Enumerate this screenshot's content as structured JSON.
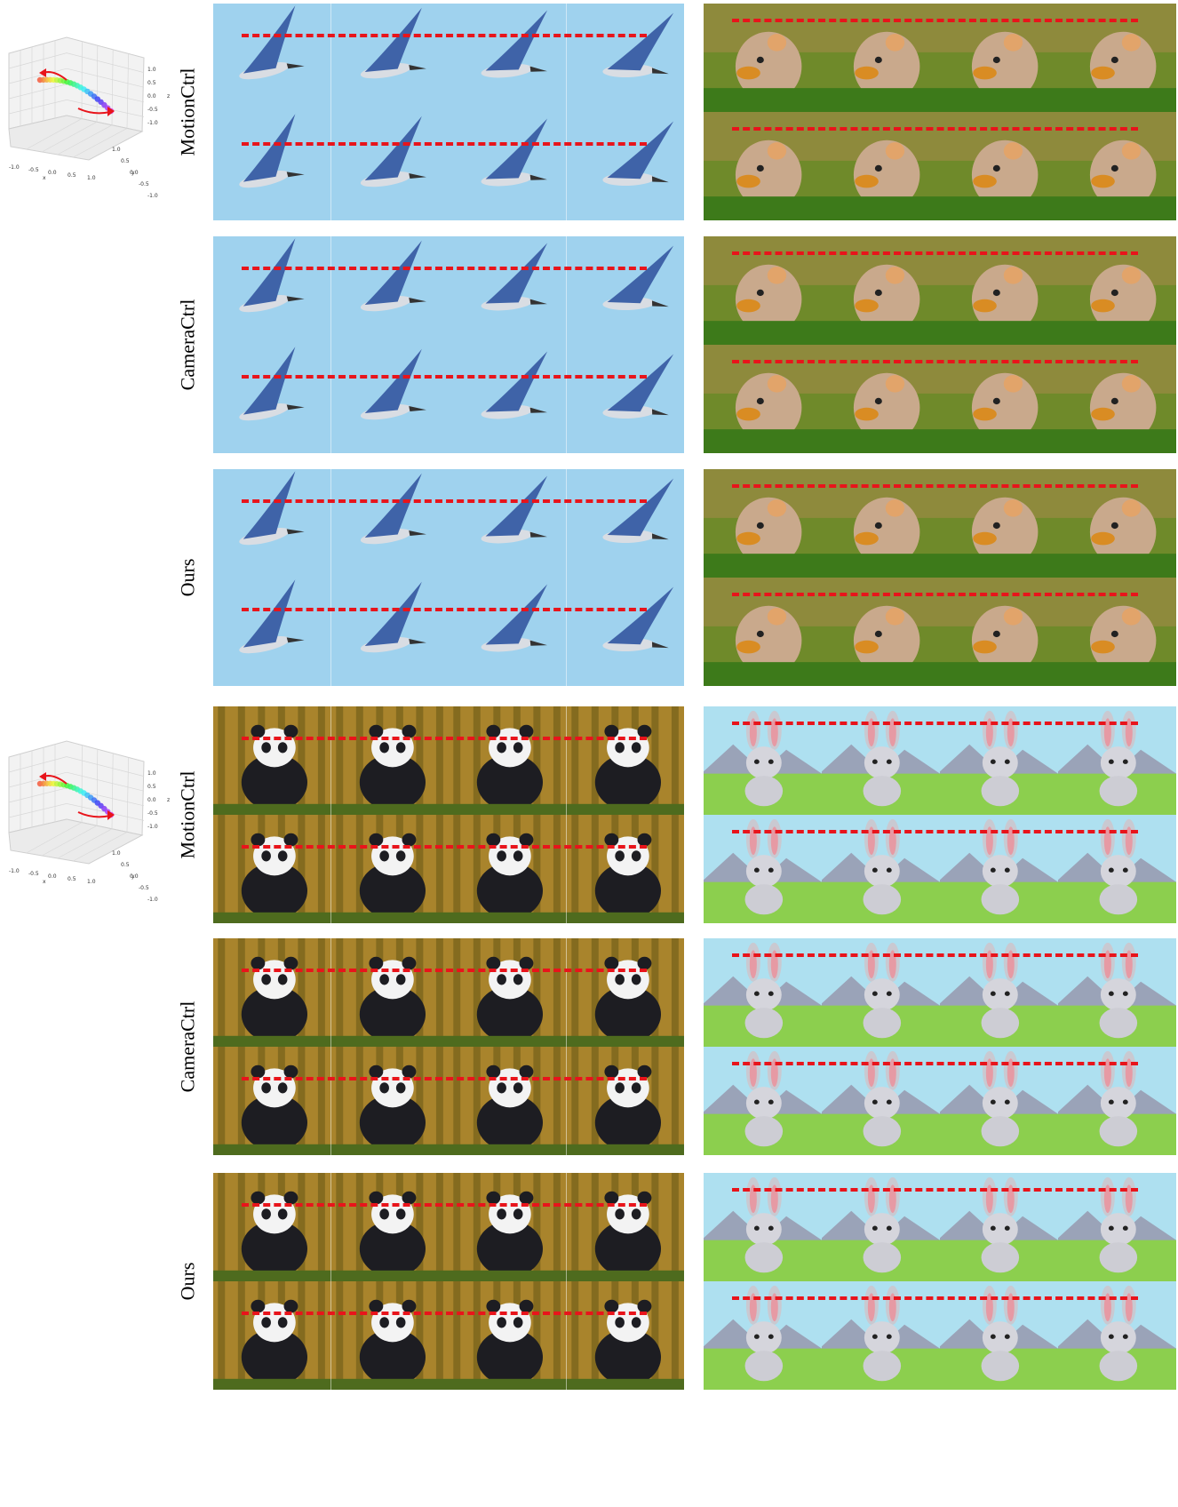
{
  "figure": {
    "row_labels": [
      "MotionCtrl",
      "CameraCtrl",
      "Ours",
      "MotionCtrl",
      "CameraCtrl",
      "Ours"
    ],
    "trajectory_plot": {
      "x_axis_label": "x",
      "y_axis_label": "y",
      "z_axis_label": "z",
      "x_ticks": [
        "-1.0",
        "-0.5",
        "0.0",
        "0.5",
        "1.0"
      ],
      "y_ticks": [
        "-1.0",
        "-0.5",
        "0.0",
        "0.5",
        "1.0"
      ],
      "z_ticks": [
        "-1.0",
        "-0.5",
        "0.0",
        "0.5",
        "1.0"
      ]
    },
    "colors": {
      "dashed_line": "#e8141b",
      "arrow": "#e8141b",
      "bird_sky": "#9fd2ee",
      "hamster_bg": "#6f8a2a",
      "panda_bg": "#a9842c",
      "bunny_sky": "#aee0f0"
    },
    "subjects": [
      "bird",
      "hamster",
      "panda",
      "bunny"
    ]
  }
}
